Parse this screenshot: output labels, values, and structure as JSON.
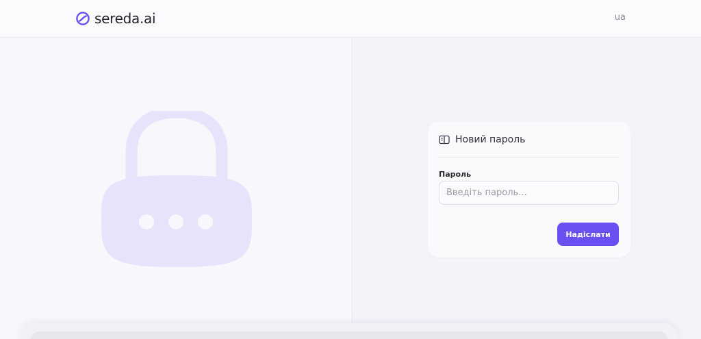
{
  "header": {
    "brand": "sereda.ai",
    "language": "ua"
  },
  "illustration": {
    "icon": "lock-icon"
  },
  "card": {
    "icon": "book-open-icon",
    "title": "Новий пароль",
    "password_label": "Пароль",
    "password_placeholder": "Введіть пароль...",
    "password_value": "",
    "submit_label": "Надіслати"
  },
  "colors": {
    "accent": "#6a4ff2",
    "lock": "#e6e3fb",
    "background": "#f9f8fc"
  }
}
